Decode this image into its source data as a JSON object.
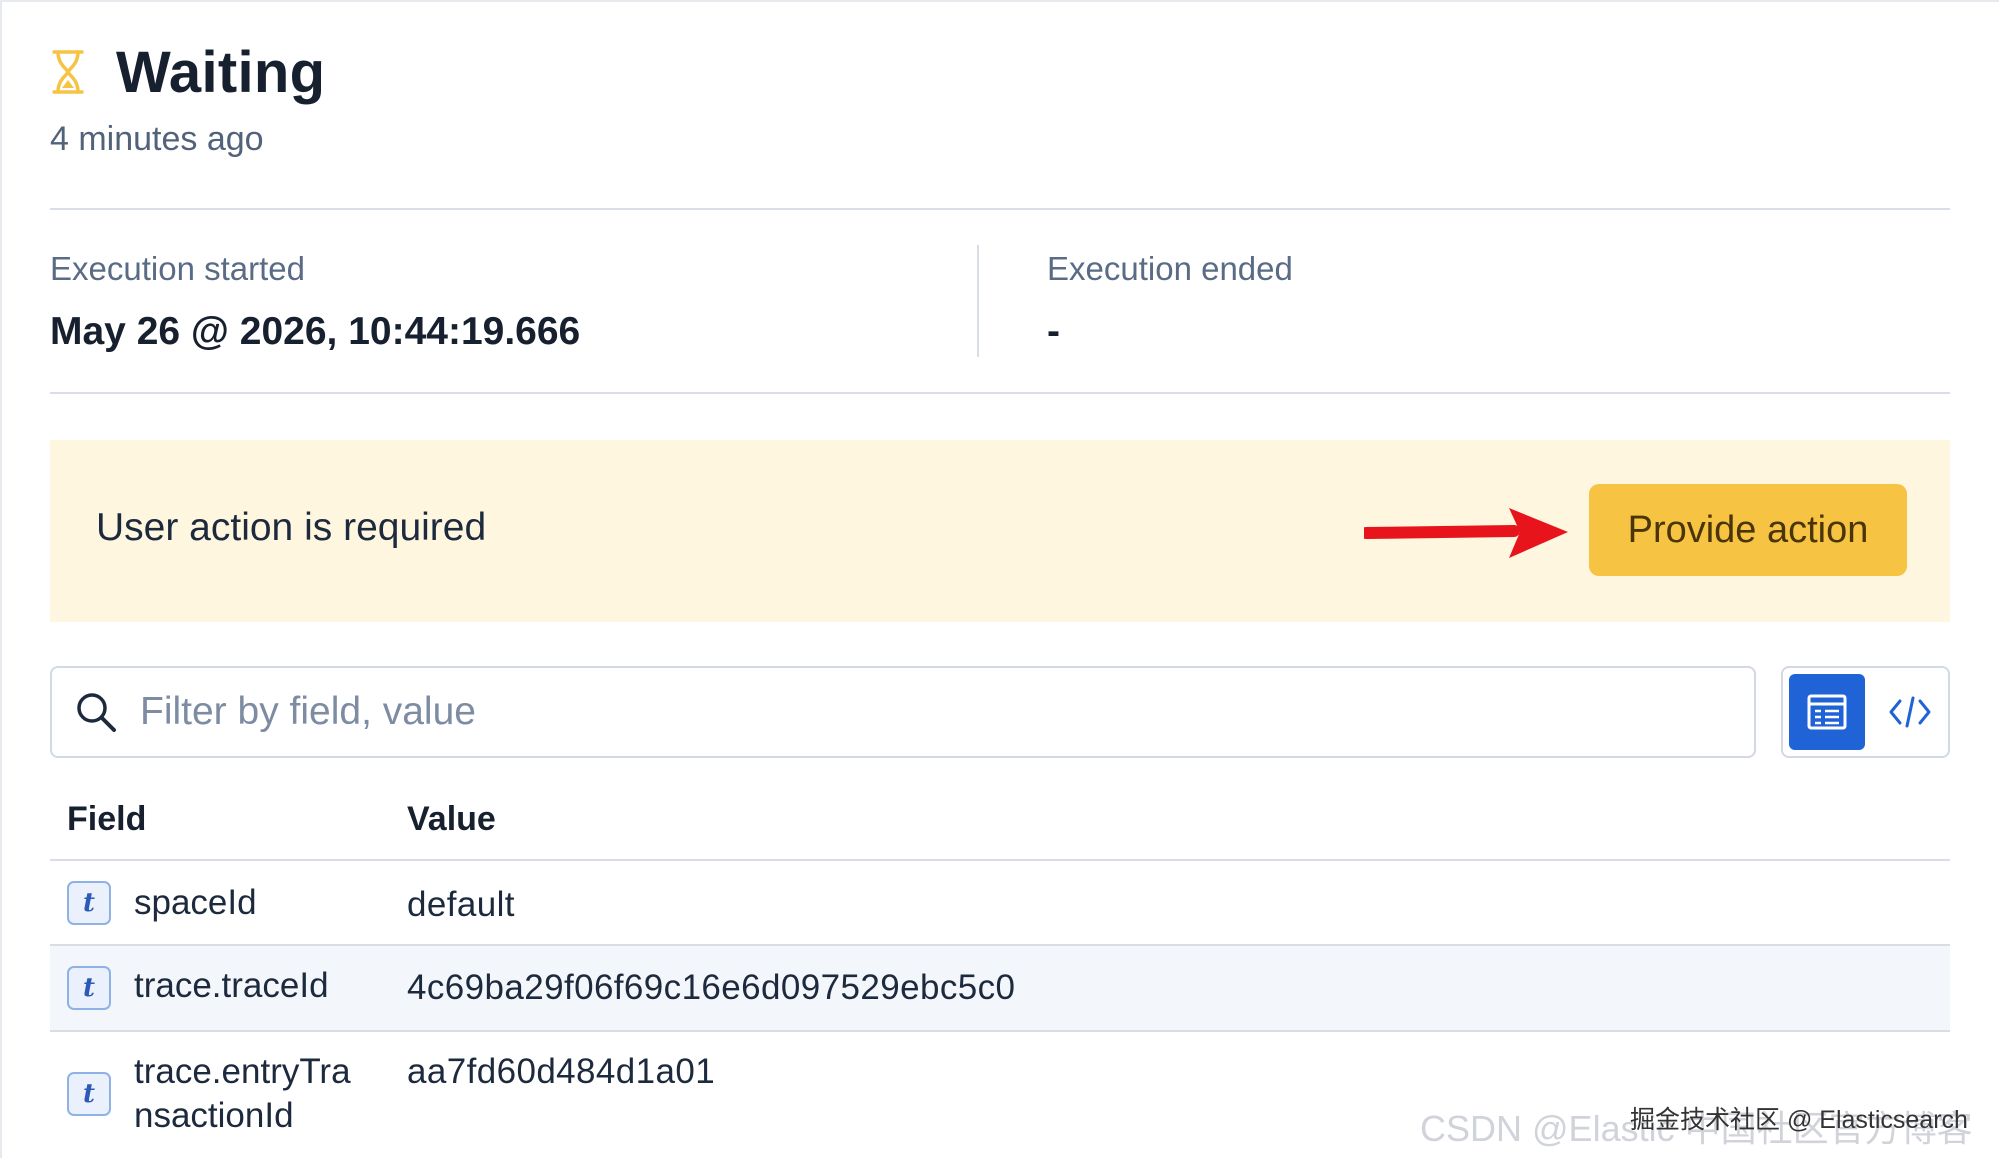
{
  "status": {
    "icon": "hourglass-icon",
    "title": "Waiting",
    "time_ago": "4 minutes ago",
    "accent_color": "#f6c343"
  },
  "execution": {
    "started_label": "Execution started",
    "started_value": "May 26 @ 2026, 10:44:19.666",
    "ended_label": "Execution ended",
    "ended_value": "-"
  },
  "callout": {
    "message": "User action is required",
    "button_label": "Provide action",
    "arrow_color": "#e8141c"
  },
  "filter": {
    "placeholder": "Filter by field, value",
    "value": ""
  },
  "view_toggle": {
    "options": [
      "table-icon",
      "code-icon"
    ],
    "selected": "table-icon",
    "selected_color": "#1f63d6"
  },
  "table": {
    "headers": {
      "field": "Field",
      "value": "Value"
    },
    "rows": [
      {
        "type": "t",
        "field": "spaceId",
        "value": "default"
      },
      {
        "type": "t",
        "field": "trace.traceId",
        "value": "4c69ba29f06f69c16e6d097529ebc5c0"
      },
      {
        "type": "t",
        "field": "trace.entryTra\nnsactionId",
        "value": "aa7fd60d484d1a01"
      }
    ]
  },
  "watermark": {
    "text1": "CSDN @Elastic 中国社区官方博客",
    "text2": "掘金技术社区 @ Elasticsearch"
  }
}
